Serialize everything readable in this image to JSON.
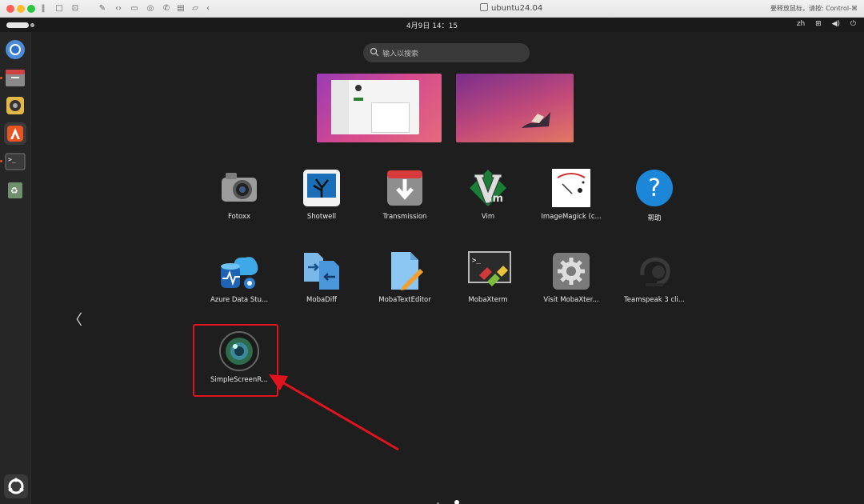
{
  "host": {
    "title": "ubuntu24.04",
    "hint": "要释放鼠标，请按: Control-⌘"
  },
  "topbar": {
    "clock": "4月9日  14：15",
    "lang": "zh"
  },
  "search": {
    "placeholder": "输入以搜索"
  },
  "apps": [
    {
      "label": "Fotoxx"
    },
    {
      "label": "Shotwell"
    },
    {
      "label": "Transmission"
    },
    {
      "label": "Vim"
    },
    {
      "label": "ImageMagick (c..."
    },
    {
      "label": "帮助"
    },
    {
      "label": "Azure Data Stu..."
    },
    {
      "label": "MobaDiff"
    },
    {
      "label": "MobaTextEditor"
    },
    {
      "label": "MobaXterm"
    },
    {
      "label": "Visit MobaXter..."
    },
    {
      "label": "Teamspeak 3 cli..."
    },
    {
      "label": "SimpleScreenR..."
    }
  ],
  "pager": {
    "pages": 2,
    "current": 2
  },
  "colors": {
    "highlight": "#e0141e",
    "ubuntu_orange": "#e95420",
    "screen_bg": "#1e1e1e"
  }
}
